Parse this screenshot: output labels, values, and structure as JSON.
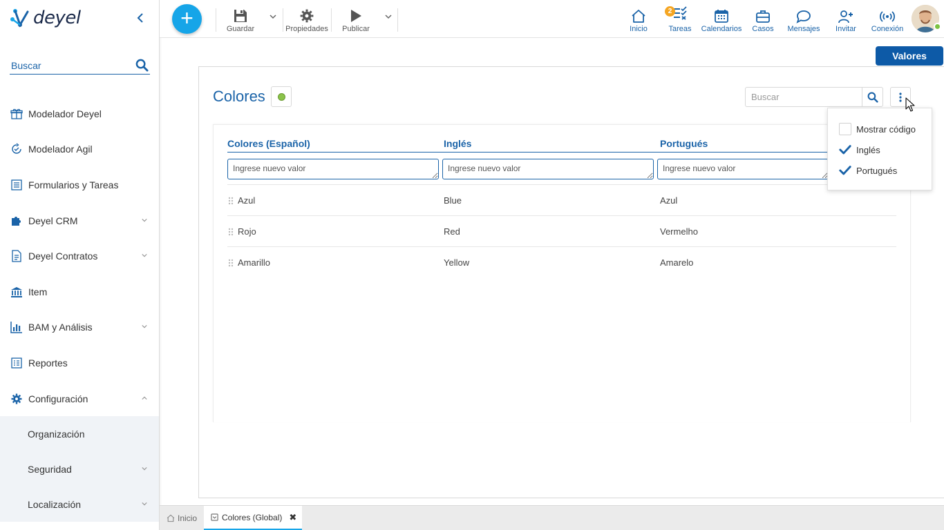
{
  "app": {
    "brand": "deyel"
  },
  "sidebar": {
    "search_placeholder": "Buscar",
    "items": [
      {
        "label": "Modelador Deyel",
        "icon": "gift-box-icon",
        "expandable": false
      },
      {
        "label": "Modelador Agil",
        "icon": "agile-cycle-icon",
        "expandable": false
      },
      {
        "label": "Formularios y Tareas",
        "icon": "form-list-icon",
        "expandable": false
      },
      {
        "label": "Deyel CRM",
        "icon": "puzzle-icon",
        "expandable": true
      },
      {
        "label": "Deyel Contratos",
        "icon": "document-icon",
        "expandable": true
      },
      {
        "label": "Item",
        "icon": "bank-icon",
        "expandable": false
      },
      {
        "label": "BAM y Análisis",
        "icon": "bar-chart-icon",
        "expandable": true
      },
      {
        "label": "Reportes",
        "icon": "report-icon",
        "expandable": false
      },
      {
        "label": "Configuración",
        "icon": "gear-icon",
        "expandable": true,
        "expanded": true
      }
    ],
    "subitems": [
      {
        "label": "Organización",
        "expandable": false
      },
      {
        "label": "Seguridad",
        "expandable": true
      },
      {
        "label": "Localización",
        "expandable": true
      }
    ]
  },
  "toolbar": {
    "save_label": "Guardar",
    "properties_label": "Propiedades",
    "publish_label": "Publicar"
  },
  "topnav": [
    {
      "label": "Inicio",
      "icon": "home-icon"
    },
    {
      "label": "Tareas",
      "icon": "tasks-icon",
      "badge": "2"
    },
    {
      "label": "Calendarios",
      "icon": "calendar-icon"
    },
    {
      "label": "Casos",
      "icon": "briefcase-icon"
    },
    {
      "label": "Mensajes",
      "icon": "chat-bubble-icon"
    },
    {
      "label": "Invitar",
      "icon": "invite-user-icon"
    },
    {
      "label": "Conexión",
      "icon": "connection-icon"
    }
  ],
  "main": {
    "values_button": "Valores",
    "title": "Colores",
    "search_placeholder": "Buscar",
    "columns": [
      "Colores (Español)",
      "Inglés",
      "Portugués"
    ],
    "new_value_placeholder": "Ingrese nuevo valor",
    "rows": [
      [
        "Azul",
        "Blue",
        "Azul"
      ],
      [
        "Rojo",
        "Red",
        "Vermelho"
      ],
      [
        "Amarillo",
        "Yellow",
        "Amarelo"
      ]
    ]
  },
  "options_menu": [
    {
      "label": "Mostrar código",
      "checked": false
    },
    {
      "label": "Inglés",
      "checked": true
    },
    {
      "label": "Portugués",
      "checked": true
    }
  ],
  "tabs": [
    {
      "label": "Inicio",
      "active": false
    },
    {
      "label": "Colores (Global)",
      "active": true
    }
  ],
  "colors": {
    "primary": "#1a63a8",
    "accent": "#16a5e8",
    "status_active": "#8bc34a",
    "badge": "#f5a623"
  }
}
